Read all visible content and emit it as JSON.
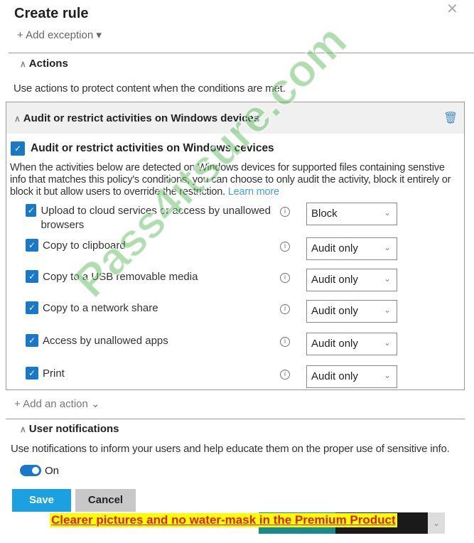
{
  "header": {
    "title": "Create rule",
    "add_exception": "+ Add exception ▾",
    "close_icon": "close-icon"
  },
  "actions": {
    "section_title": "Actions",
    "description": "Use actions to protect content when the conditions are met.",
    "card": {
      "title": "Audit or restrict activities on Windows devices",
      "checkbox_label": "Audit or restrict activities on Windows cevices",
      "checked": true,
      "description": "When the activities below are detected on Windows devices for supported files containing senstive info that matches this policy's conditions, you can choose to only audit the activity, block it entirely or block it but allow users to override the restriction.",
      "learn_more": "Learn more",
      "activities": [
        {
          "label": "Upload to cloud services or access by unallowed browsers",
          "checked": true,
          "value": "Block"
        },
        {
          "label": "Copy to clipboard",
          "checked": true,
          "value": "Audit only"
        },
        {
          "label": "Copy to a USB removable media",
          "checked": true,
          "value": "Audit only"
        },
        {
          "label": "Copy to a network share",
          "checked": true,
          "value": "Audit only"
        },
        {
          "label": "Access by unallowed apps",
          "checked": true,
          "value": "Audit only"
        },
        {
          "label": "Print",
          "checked": true,
          "value": "Audit only"
        }
      ]
    },
    "add_action": "+ Add an action ⌄"
  },
  "notifications": {
    "section_title": "User notifications",
    "description": "Use notifications to inform your users and help educate them on the proper use of sensitive info.",
    "toggle_on": true,
    "toggle_label": "On"
  },
  "footer": {
    "save": "Save",
    "cancel": "Cancel"
  },
  "watermark": "Pass4itsure.com",
  "banner": "Clearer pictures and no water-mask in the Premium Product",
  "colors": {
    "accent": "#1a78c8",
    "save_button": "#1ba1e2",
    "cancel_button": "#c8c8c8",
    "link": "#4aa3d8"
  }
}
